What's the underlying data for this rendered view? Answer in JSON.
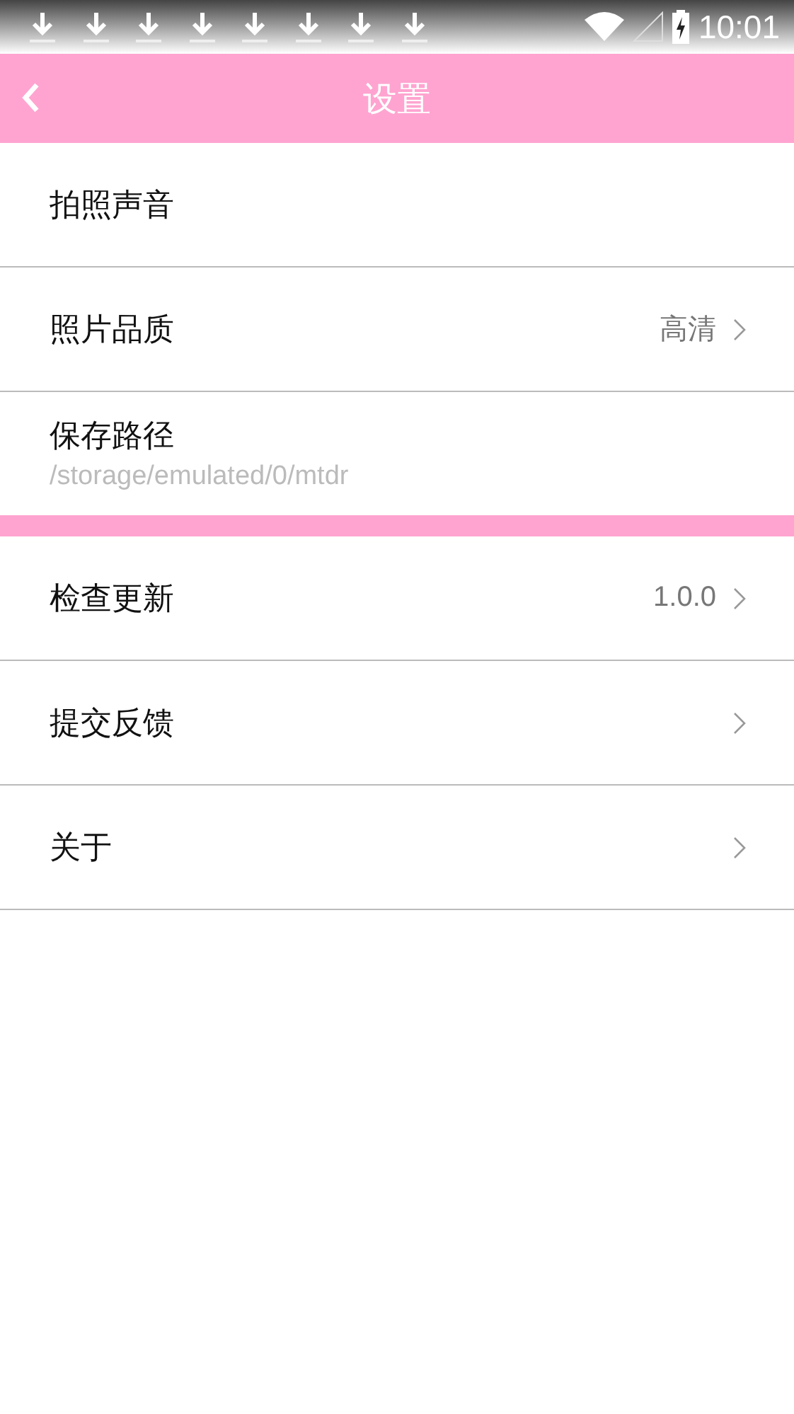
{
  "status_bar": {
    "time": "10:01"
  },
  "header": {
    "title": "设置"
  },
  "groups": [
    {
      "items": [
        {
          "kind": "plain",
          "label": "拍照声音"
        },
        {
          "kind": "link",
          "label": "照片品质",
          "value": "高清"
        },
        {
          "kind": "path",
          "label": "保存路径",
          "subtitle": "/storage/emulated/0/mtdr"
        }
      ]
    },
    {
      "items": [
        {
          "kind": "link",
          "label": "检查更新",
          "value": "1.0.0"
        },
        {
          "kind": "link",
          "label": "提交反馈"
        },
        {
          "kind": "link",
          "label": "关于"
        }
      ]
    }
  ]
}
